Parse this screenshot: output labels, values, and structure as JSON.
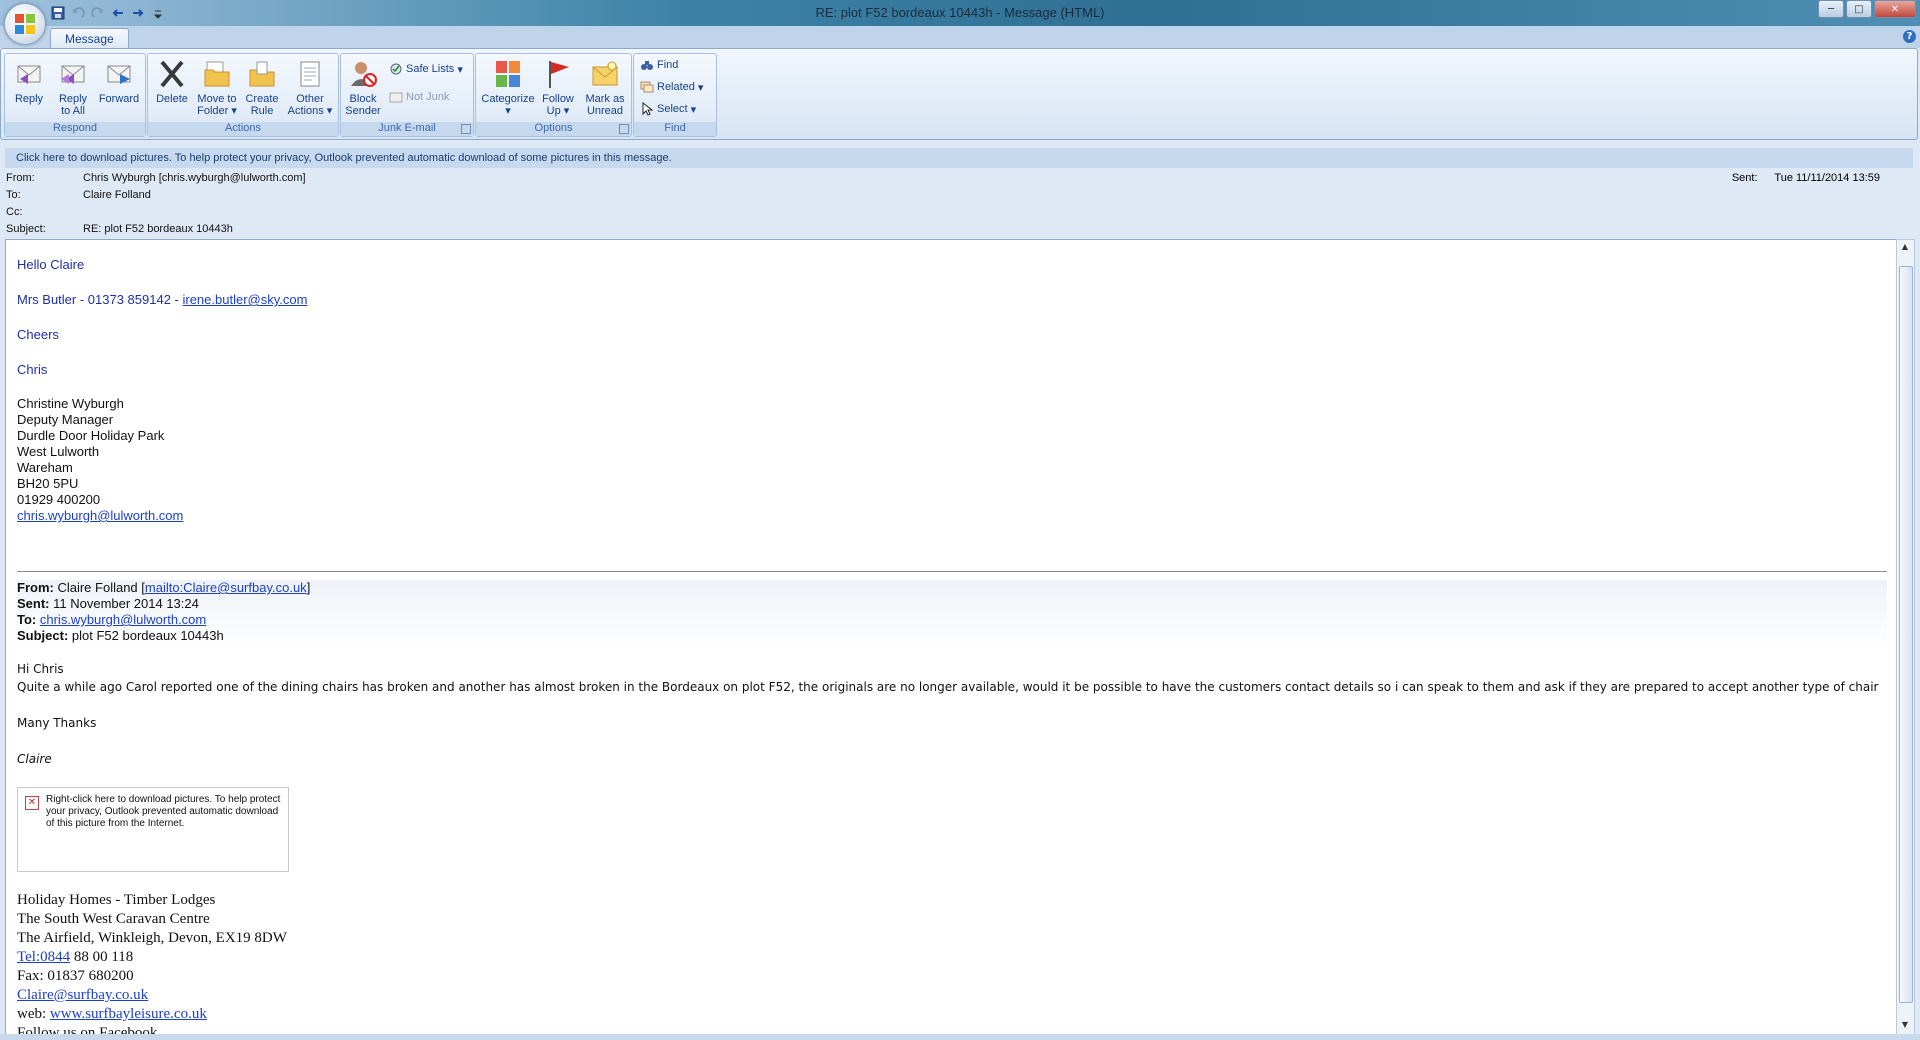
{
  "window": {
    "title": "RE: plot F52 bordeaux 10443h - Message (HTML)",
    "controls": {
      "minimize": "─",
      "maximize": "□",
      "close": "✕"
    }
  },
  "ribbon": {
    "tab": "Message",
    "help": "?",
    "groups": {
      "respond": {
        "label": "Respond",
        "reply": "Reply",
        "reply_all_1": "Reply",
        "reply_all_2": "to All",
        "forward": "Forward"
      },
      "actions": {
        "label": "Actions",
        "delete": "Delete",
        "move_1": "Move to",
        "move_2": "Folder",
        "create_1": "Create",
        "create_2": "Rule",
        "other_1": "Other",
        "other_2": "Actions"
      },
      "junk": {
        "label": "Junk E-mail",
        "block_1": "Block",
        "block_2": "Sender",
        "safe_lists": "Safe Lists",
        "not_junk": "Not Junk"
      },
      "options": {
        "label": "Options",
        "categorize": "Categorize",
        "follow_1": "Follow",
        "follow_2": "Up",
        "mark_1": "Mark as",
        "mark_2": "Unread"
      },
      "find": {
        "label": "Find",
        "find": "Find",
        "related": "Related",
        "select": "Select"
      }
    }
  },
  "infobar": "Click here to download pictures. To help protect your privacy, Outlook prevented automatic download of some pictures in this message.",
  "header": {
    "from_label": "From:",
    "from": "Chris Wyburgh [chris.wyburgh@lulworth.com]",
    "to_label": "To:",
    "to": "Claire Folland",
    "cc_label": "Cc:",
    "cc": "",
    "subject_label": "Subject:",
    "subject": "RE: plot F52 bordeaux 10443h",
    "sent_label": "Sent:",
    "sent": "Tue 11/11/2014 13:59"
  },
  "body": {
    "greeting": "Hello Claire",
    "contact_text": "Mrs Butler - 01373 859142 - ",
    "contact_email": "irene.butler@sky.com",
    "cheers": "Cheers",
    "sign": "Chris",
    "sig": [
      "Christine Wyburgh",
      "Deputy Manager",
      "Durdle Door Holiday Park",
      "West Lulworth",
      "Wareham",
      "BH20 5PU",
      "01929 400200"
    ],
    "sig_email": "chris.wyburgh@lulworth.com",
    "quote": {
      "from_label": "From:",
      "from_name": " Claire Folland [",
      "from_link": "mailto:Claire@surfbay.co.uk",
      "from_end": "]",
      "sent_label": "Sent:",
      "sent": " 11 November 2014 13:24",
      "to_label": "To:",
      "to_link": "chris.wyburgh@lulworth.com",
      "subject_label": "Subject:",
      "subject": " plot F52 bordeaux 10443h"
    },
    "quoted_greeting": "Hi Chris",
    "quoted_text": "Quite a while ago Carol reported one of the dining chairs has broken and another has almost broken in the Bordeaux on plot F52, the originals are no longer available, would it be possible to have the customers contact details so i can speak to them and ask if they are prepared to accept another type of chair",
    "many_thanks": "Many Thanks",
    "claire": "Claire",
    "blocked_image_text": "Right-click here to download pictures.  To help protect your privacy, Outlook prevented automatic download of this picture from the Internet.",
    "company": {
      "line1": "Holiday Homes - Timber Lodges",
      "line2": "The South West Caravan Centre",
      "line3": "The Airfield, Winkleigh, Devon, EX19 8DW",
      "tel_link": "Tel:0844",
      "tel_rest": " 88 00 118",
      "fax": "Fax: 01837 680200",
      "email": "Claire@surfbay.co.uk",
      "web_label": "web: ",
      "web": "www.surfbayleisure.co.uk",
      "follow": "Follow us on Facebook"
    }
  }
}
